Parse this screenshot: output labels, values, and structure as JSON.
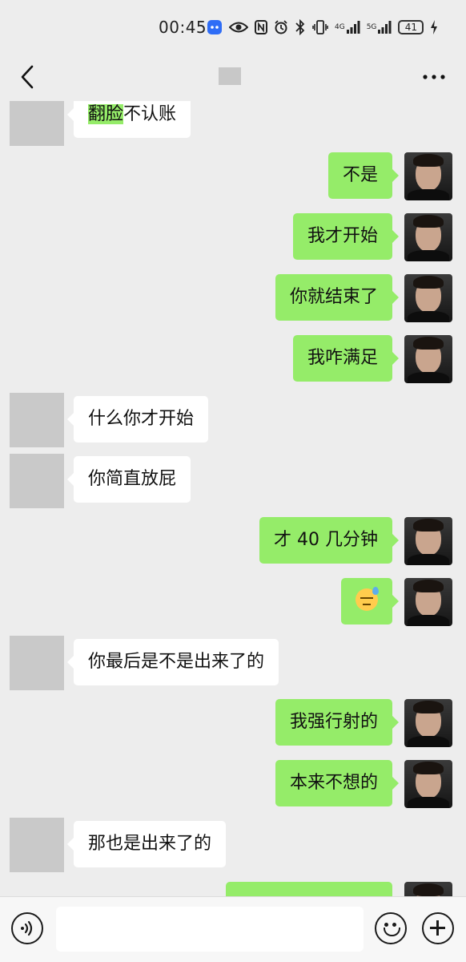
{
  "status_bar": {
    "time": "00:45",
    "network_4g": "4G",
    "network_5g": "5G",
    "battery": "41",
    "icons": [
      "app-notification-icon",
      "eye-icon",
      "nfc-icon",
      "alarm-icon",
      "bluetooth-icon",
      "vibrate-icon",
      "signal-4g-icon",
      "signal-5g-icon",
      "battery-icon",
      "charging-icon"
    ]
  },
  "header": {
    "back_icon": "chevron-left-icon",
    "more_icon": "more-dots-icon"
  },
  "messages": [
    {
      "side": "left",
      "highlight": "翻脸",
      "rest": "不认账"
    },
    {
      "side": "right",
      "text": "不是"
    },
    {
      "side": "right",
      "text": "我才开始"
    },
    {
      "side": "right",
      "text": "你就结束了"
    },
    {
      "side": "right",
      "text": "我咋满足"
    },
    {
      "side": "left",
      "text": "什么你才开始"
    },
    {
      "side": "left",
      "text": "你简直放屁"
    },
    {
      "side": "right",
      "text": "才 40 几分钟"
    },
    {
      "side": "right",
      "emoji": "sweat-smile-emoji"
    },
    {
      "side": "left",
      "text": "你最后是不是出来了的"
    },
    {
      "side": "right",
      "text": "我强行射的"
    },
    {
      "side": "right",
      "text": "本来不想的"
    },
    {
      "side": "left",
      "text": "那也是出来了的"
    }
  ],
  "input_bar": {
    "voice_icon": "voice-icon",
    "input_value": "",
    "emoji_icon": "emoji-icon",
    "plus_icon": "plus-icon"
  },
  "colors": {
    "background": "#ededed",
    "bubble_self": "#95ec69",
    "bubble_other": "#ffffff"
  }
}
